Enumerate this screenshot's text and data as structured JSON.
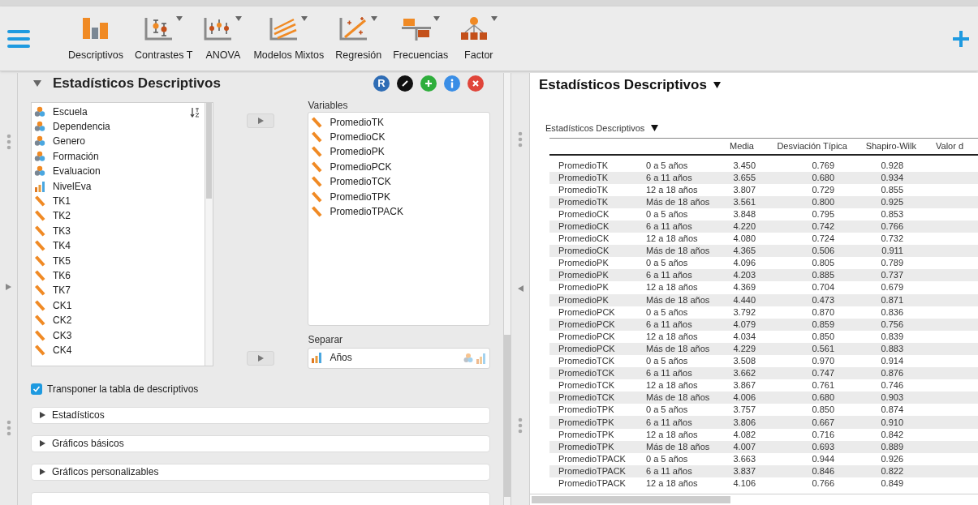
{
  "toolbar": {
    "items": [
      {
        "label": "Descriptivos",
        "has_menu": false
      },
      {
        "label": "Contrastes T",
        "has_menu": true
      },
      {
        "label": "ANOVA",
        "has_menu": true
      },
      {
        "label": "Modelos Mixtos",
        "has_menu": true
      },
      {
        "label": "Regresión",
        "has_menu": true
      },
      {
        "label": "Frecuencias",
        "has_menu": true
      },
      {
        "label": "Factor",
        "has_menu": true
      }
    ]
  },
  "analysis": {
    "title": "Estadísticos Descriptivos",
    "expanded": true,
    "header_buttons": [
      {
        "kind": "r",
        "label": "R",
        "color": "#2f6db5"
      },
      {
        "kind": "edit",
        "color": "#111111"
      },
      {
        "kind": "add",
        "color": "#2eae3c"
      },
      {
        "kind": "info",
        "color": "#3a8ee6"
      },
      {
        "kind": "close",
        "color": "#e0453a"
      }
    ],
    "available_variables": [
      {
        "name": "Escuela",
        "kind": "nominal"
      },
      {
        "name": "Dependencia",
        "kind": "nominal"
      },
      {
        "name": "Genero",
        "kind": "nominal"
      },
      {
        "name": "Formación",
        "kind": "nominal"
      },
      {
        "name": "Evaluacion",
        "kind": "nominal"
      },
      {
        "name": "NivelEva",
        "kind": "ordinal"
      },
      {
        "name": "TK1",
        "kind": "scale"
      },
      {
        "name": "TK2",
        "kind": "scale"
      },
      {
        "name": "TK3",
        "kind": "scale"
      },
      {
        "name": "TK4",
        "kind": "scale"
      },
      {
        "name": "TK5",
        "kind": "scale"
      },
      {
        "name": "TK6",
        "kind": "scale"
      },
      {
        "name": "TK7",
        "kind": "scale"
      },
      {
        "name": "CK1",
        "kind": "scale"
      },
      {
        "name": "CK2",
        "kind": "scale"
      },
      {
        "name": "CK3",
        "kind": "scale"
      },
      {
        "name": "CK4",
        "kind": "scale"
      }
    ],
    "variables": {
      "label": "Variables",
      "items": [
        {
          "name": "PromedioTK",
          "kind": "scale"
        },
        {
          "name": "PromedioCK",
          "kind": "scale"
        },
        {
          "name": "PromedioPK",
          "kind": "scale"
        },
        {
          "name": "PromedioPCK",
          "kind": "scale"
        },
        {
          "name": "PromedioTCK",
          "kind": "scale"
        },
        {
          "name": "PromedioTPK",
          "kind": "scale"
        },
        {
          "name": "PromedioTPACK",
          "kind": "scale"
        }
      ]
    },
    "split": {
      "label": "Separar",
      "items": [
        {
          "name": "Años",
          "kind": "ordinal"
        }
      ]
    },
    "transpose": {
      "label": "Transponer la tabla de descriptivos",
      "checked": true
    },
    "sections": [
      {
        "label": "Estadísticos",
        "expanded": false
      },
      {
        "label": "Gráficos básicos",
        "expanded": false
      },
      {
        "label": "Gráficos personalizables",
        "expanded": false
      }
    ]
  },
  "results": {
    "title": "Estadísticos Descriptivos",
    "table": {
      "title": "Estadísticos Descriptivos",
      "columns": [
        "",
        "",
        "Media",
        "Desviación Típica",
        "Shapiro-Wilk",
        "Valor d"
      ],
      "rows": [
        [
          "PromedioTK",
          "0 a 5 años",
          "3.450",
          "0.769",
          "0.928"
        ],
        [
          "PromedioTK",
          "6 a 11 años",
          "3.655",
          "0.680",
          "0.934"
        ],
        [
          "PromedioTK",
          "12 a 18 años",
          "3.807",
          "0.729",
          "0.855"
        ],
        [
          "PromedioTK",
          "Más de 18 años",
          "3.561",
          "0.800",
          "0.925"
        ],
        [
          "PromedioCK",
          "0 a 5 años",
          "3.848",
          "0.795",
          "0.853"
        ],
        [
          "PromedioCK",
          "6 a 11 años",
          "4.220",
          "0.742",
          "0.766"
        ],
        [
          "PromedioCK",
          "12 a 18 años",
          "4.080",
          "0.724",
          "0.732"
        ],
        [
          "PromedioCK",
          "Más de 18 años",
          "4.365",
          "0.506",
          "0.911"
        ],
        [
          "PromedioPK",
          "0 a 5 años",
          "4.096",
          "0.805",
          "0.789"
        ],
        [
          "PromedioPK",
          "6 a 11 años",
          "4.203",
          "0.885",
          "0.737"
        ],
        [
          "PromedioPK",
          "12 a 18 años",
          "4.369",
          "0.704",
          "0.679"
        ],
        [
          "PromedioPK",
          "Más de 18 años",
          "4.440",
          "0.473",
          "0.871"
        ],
        [
          "PromedioPCK",
          "0 a 5 años",
          "3.792",
          "0.870",
          "0.836"
        ],
        [
          "PromedioPCK",
          "6 a 11 años",
          "4.079",
          "0.859",
          "0.756"
        ],
        [
          "PromedioPCK",
          "12 a 18 años",
          "4.034",
          "0.850",
          "0.839"
        ],
        [
          "PromedioPCK",
          "Más de 18 años",
          "4.229",
          "0.561",
          "0.883"
        ],
        [
          "PromedioTCK",
          "0 a 5 años",
          "3.508",
          "0.970",
          "0.914"
        ],
        [
          "PromedioTCK",
          "6 a 11 años",
          "3.662",
          "0.747",
          "0.876"
        ],
        [
          "PromedioTCK",
          "12 a 18 años",
          "3.867",
          "0.761",
          "0.746"
        ],
        [
          "PromedioTCK",
          "Más de 18 años",
          "4.006",
          "0.680",
          "0.903"
        ],
        [
          "PromedioTPK",
          "0 a 5 años",
          "3.757",
          "0.850",
          "0.874"
        ],
        [
          "PromedioTPK",
          "6 a 11 años",
          "3.806",
          "0.667",
          "0.910"
        ],
        [
          "PromedioTPK",
          "12 a 18 años",
          "4.082",
          "0.716",
          "0.842"
        ],
        [
          "PromedioTPK",
          "Más de 18 años",
          "4.007",
          "0.693",
          "0.889"
        ],
        [
          "PromedioTPACK",
          "0 a 5 años",
          "3.663",
          "0.944",
          "0.926"
        ],
        [
          "PromedioTPACK",
          "6 a 11 años",
          "3.837",
          "0.846",
          "0.822"
        ],
        [
          "PromedioTPACK",
          "12 a 18 años",
          "4.106",
          "0.766",
          "0.849"
        ]
      ]
    }
  }
}
